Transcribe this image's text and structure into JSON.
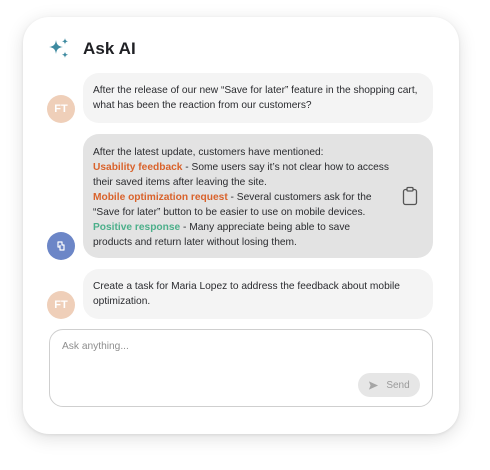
{
  "header": {
    "title": "Ask AI",
    "icon": "sparkle-icon",
    "accent": "#3e8aa0"
  },
  "messages": [
    {
      "role": "user",
      "avatar": "FT",
      "text": "After the release of our new “Save for later” feature in the shopping cart, what has been the reaction from our customers?"
    },
    {
      "role": "assistant",
      "avatar_icon": "ai-assistant-icon",
      "intro": "After the latest update, customers have mentioned:",
      "points": [
        {
          "label": "Usability feedback",
          "text": " - Some users say it’s not clear how to access their saved items after leaving the site.",
          "color": "#d9622b"
        },
        {
          "label": "Mobile optimization request",
          "text": " - Several customers ask for the “Save for later” button to be easier to use on mobile devices.",
          "color": "#d9622b"
        },
        {
          "label": "Positive response",
          "text": " - Many appreciate being able to save products and return later without losing them.",
          "color": "#4caf8a"
        }
      ],
      "action_icon": "clipboard-icon"
    },
    {
      "role": "user",
      "avatar": "FT",
      "text": "Create a task for Maria Lopez to address the feedback about mobile optimization."
    }
  ],
  "composer": {
    "placeholder": "Ask anything...",
    "send_label": "Send",
    "send_icon": "send-icon"
  }
}
